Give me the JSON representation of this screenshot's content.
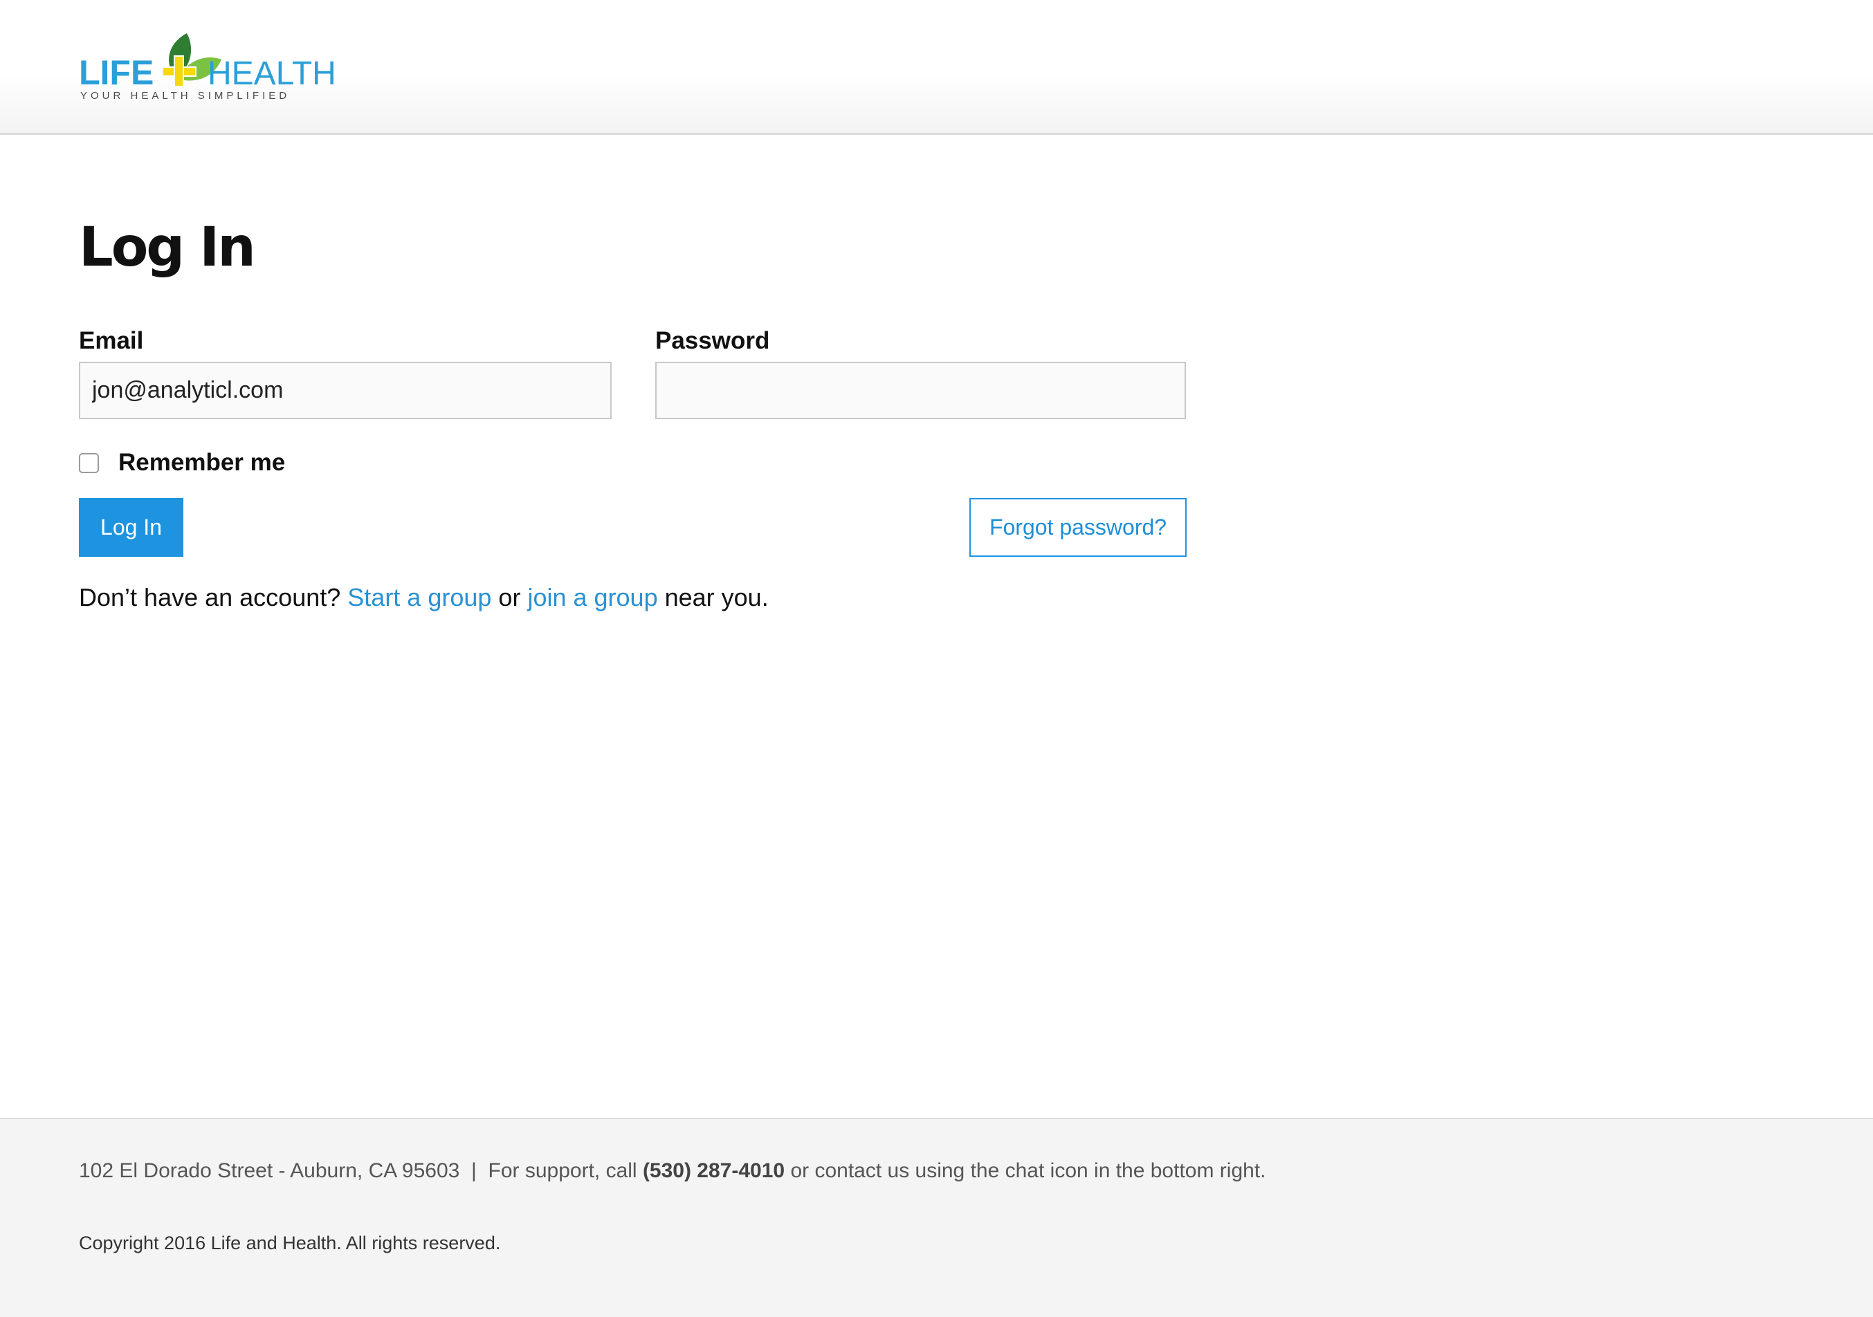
{
  "brand": {
    "word_left": "LIFE",
    "word_right": "HEALTH",
    "tagline": "YOUR HEALTH SIMPLIFIED",
    "colors": {
      "blue": "#2a9fd8",
      "leaf_dark": "#2e7d32",
      "leaf_light": "#7cc242",
      "cross": "#f5d90a"
    }
  },
  "page": {
    "title": "Log In"
  },
  "form": {
    "email_label": "Email",
    "email_value": "jon@analyticl.com",
    "password_label": "Password",
    "password_value": "",
    "remember_label": "Remember me",
    "remember_checked": false,
    "login_button": "Log In",
    "forgot_button": "Forgot password?"
  },
  "signup": {
    "prefix": "Don’t have an account?",
    "start_link": "Start a group",
    "middle": "or",
    "join_link": "join a group",
    "suffix": "near you."
  },
  "footer": {
    "address": "102 El Dorado Street - Auburn, CA 95603",
    "separator": "|",
    "support_prefix": "For support, call",
    "phone": "(530) 287-4010",
    "support_suffix": "or contact us using the chat icon in the bottom right.",
    "copyright": "Copyright 2016 Life and Health. All rights reserved."
  },
  "colors": {
    "accent": "#1e93e0",
    "link": "#2a91d3",
    "footer_bg": "#f4f4f4"
  }
}
